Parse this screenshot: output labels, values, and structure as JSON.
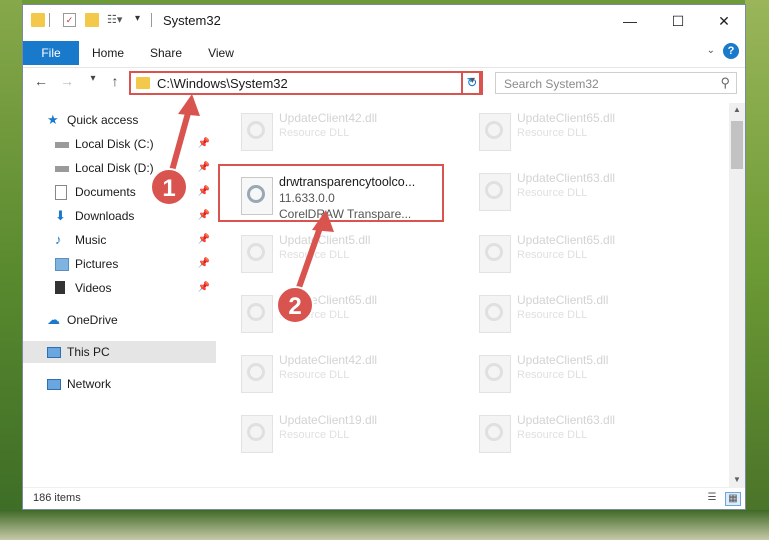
{
  "window": {
    "title": "System32"
  },
  "ribbon": {
    "tabs": [
      {
        "label": "File"
      },
      {
        "label": "Home"
      },
      {
        "label": "Share"
      },
      {
        "label": "View"
      }
    ],
    "help": "?"
  },
  "address": {
    "path": "C:\\Windows\\System32",
    "search_placeholder": "Search System32"
  },
  "nav": {
    "items": [
      {
        "label": "Quick access"
      },
      {
        "label": "Local Disk (C:)"
      },
      {
        "label": "Local Disk (D:)"
      },
      {
        "label": "Documents"
      },
      {
        "label": "Downloads"
      },
      {
        "label": "Music"
      },
      {
        "label": "Pictures"
      },
      {
        "label": "Videos"
      },
      {
        "label": "OneDrive"
      },
      {
        "label": "This PC"
      },
      {
        "label": "Network"
      }
    ]
  },
  "files": [
    {
      "name": "UpdateClient42.dll",
      "type": "Resource DLL"
    },
    {
      "name": "UpdateClient65.dll",
      "type": "Resource DLL"
    },
    {
      "name": "drwtransparencytoolco...",
      "version": "11.633.0.0",
      "type": "CorelDRAW Transpare..."
    },
    {
      "name": "UpdateClient63.dll",
      "type": "Resource DLL"
    },
    {
      "name": "UpdateClient5.dll",
      "type": "Resource DLL"
    },
    {
      "name": "UpdateClient65.dll",
      "type": "Resource DLL"
    },
    {
      "name": "UpdateClient65.dll",
      "type": "Resource DLL"
    },
    {
      "name": "UpdateClient5.dll",
      "type": "Resource DLL"
    },
    {
      "name": "UpdateClient42.dll",
      "type": "Resource DLL"
    },
    {
      "name": "UpdateClient5.dll",
      "type": "Resource DLL"
    },
    {
      "name": "UpdateClient19.dll",
      "type": "Resource DLL"
    },
    {
      "name": "UpdateClient63.dll",
      "type": "Resource DLL"
    }
  ],
  "status": {
    "item_count": "186 items"
  },
  "annotations": {
    "step1": "1",
    "step2": "2"
  },
  "colors": {
    "accent": "#1979ca",
    "highlight": "#d9534f",
    "nav_selected": "#cde8ff"
  }
}
